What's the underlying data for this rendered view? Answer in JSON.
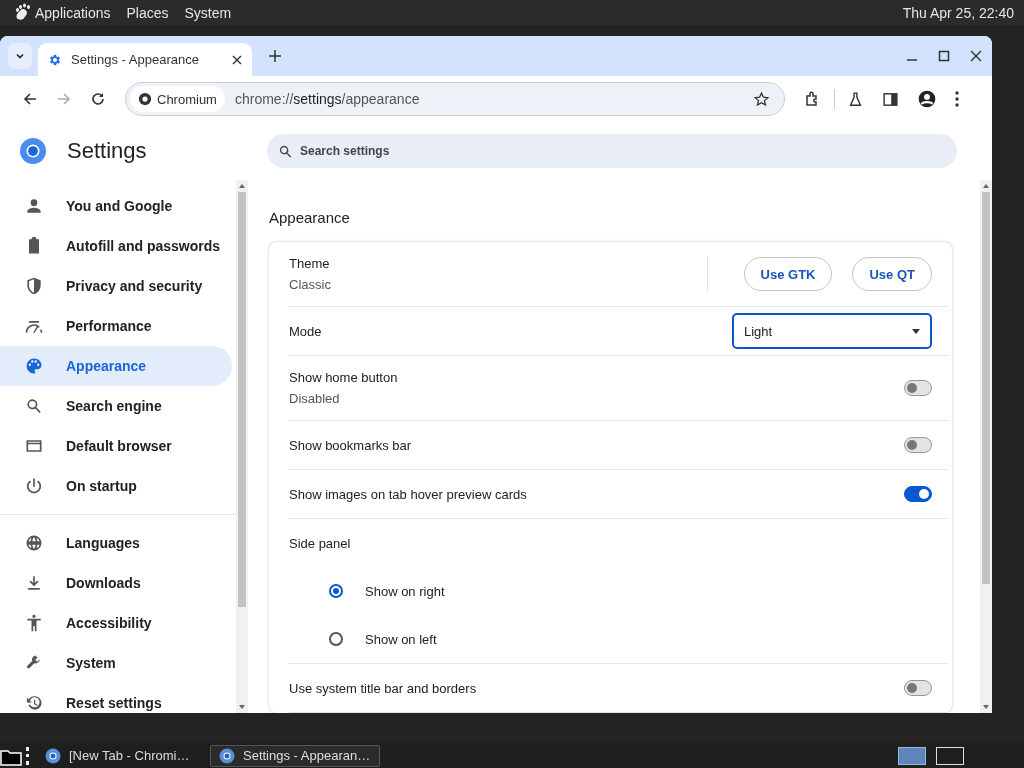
{
  "top_panel": {
    "menus": [
      "Applications",
      "Places",
      "System"
    ],
    "clock": "Thu Apr 25, 22:40"
  },
  "tabs": [
    {
      "title": "Settings - Appearance",
      "selected": true
    }
  ],
  "address_bar": {
    "site_chip": "Chromium",
    "url": "chrome://**settings**/appearance"
  },
  "settings": {
    "title": "Settings",
    "search": {
      "placeholder": "Search settings"
    }
  },
  "sidebar": {
    "groups": [
      [
        {
          "label": "You and Google",
          "selected": false
        },
        {
          "label": "Autofill and passwords",
          "selected": false
        },
        {
          "label": "Privacy and security",
          "selected": false
        },
        {
          "label": "Performance",
          "selected": false
        },
        {
          "label": "Appearance",
          "selected": true
        },
        {
          "label": "Search engine",
          "selected": false
        },
        {
          "label": "Default browser",
          "selected": false
        },
        {
          "label": "On startup",
          "selected": false
        }
      ],
      [
        {
          "label": "Languages",
          "selected": false
        },
        {
          "label": "Downloads",
          "selected": false
        },
        {
          "label": "Accessibility",
          "selected": false
        },
        {
          "label": "System",
          "selected": false
        },
        {
          "label": "Reset settings",
          "selected": false
        }
      ]
    ]
  },
  "section": {
    "heading": "Appearance",
    "rows": [
      {
        "kind": "theme",
        "label": "Theme",
        "value": "Classic",
        "buttons": [
          "Use GTK",
          "Use QT"
        ]
      },
      {
        "kind": "select",
        "label": "Mode",
        "value": "Light"
      },
      {
        "kind": "toggle",
        "label": "Show home button",
        "sublabel": "Disabled",
        "on": false
      },
      {
        "kind": "toggle",
        "label": "Show bookmarks bar",
        "on": false
      },
      {
        "kind": "toggle",
        "label": "Show images on tab hover preview cards",
        "on": true
      },
      {
        "kind": "heading",
        "label": "Side panel"
      },
      {
        "kind": "radio",
        "label": "Show on right",
        "selected": true
      },
      {
        "kind": "radio",
        "label": "Show on left",
        "selected": false
      },
      {
        "kind": "toggle",
        "label": "Use system title bar and borders",
        "on": false
      }
    ]
  },
  "taskbar": {
    "items": [
      {
        "title": "[New Tab - Chromi…",
        "selected": false
      },
      {
        "title": "Settings - Appearan…",
        "selected": true
      }
    ],
    "workspaces": [
      {
        "selected": true
      },
      {
        "selected": false
      }
    ]
  }
}
